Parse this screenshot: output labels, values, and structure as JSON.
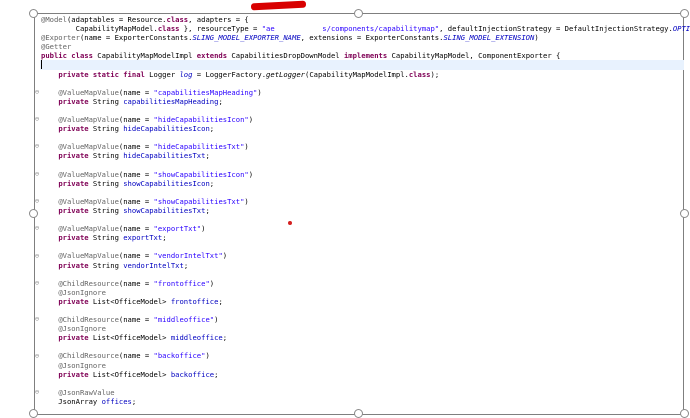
{
  "editor": {
    "lines": [
      [
        {
          "t": "@Model",
          "c": "a"
        },
        {
          "t": "(adaptables = Resource."
        },
        {
          "t": "class",
          "c": "k"
        },
        {
          "t": ", adapters = {"
        }
      ],
      [
        {
          "t": "        CapabilityMapModel."
        },
        {
          "t": "class",
          "c": "k"
        },
        {
          "t": " }, resourceType = "
        },
        {
          "t": "\"ae",
          "c": "s"
        },
        {
          "t": "           ",
          "c": "s"
        },
        {
          "t": "s/components/capabilitymap\"",
          "c": "s"
        },
        {
          "t": ", defaultInjectionStrategy = DefaultInjectionStrategy."
        },
        {
          "t": "OPTIONAL",
          "c": "fi"
        },
        {
          "t": ")"
        }
      ],
      [
        {
          "t": "@Exporter",
          "c": "a"
        },
        {
          "t": "(name = ExporterConstants."
        },
        {
          "t": "SLING_MODEL_EXPORTER_NAME",
          "c": "fi"
        },
        {
          "t": ", extensions = ExporterConstants."
        },
        {
          "t": "SLING_MODEL_EXTENSION",
          "c": "fi"
        },
        {
          "t": ")"
        }
      ],
      [
        {
          "t": "@Getter",
          "c": "a"
        }
      ],
      [
        {
          "t": "public class",
          "c": "k"
        },
        {
          "t": " CapabilityMapModelImpl "
        },
        {
          "t": "extends",
          "c": "k"
        },
        {
          "t": " CapabilitiesDropDownModel "
        },
        {
          "t": "implements",
          "c": "k"
        },
        {
          "t": " CapabilityMapModel, ComponentExporter {"
        }
      ],
      [],
      [
        {
          "t": "    "
        },
        {
          "t": "private static final",
          "c": "k"
        },
        {
          "t": " Logger "
        },
        {
          "t": "log",
          "c": "fi"
        },
        {
          "t": " = LoggerFactory."
        },
        {
          "t": "getLogger",
          "c": "it"
        },
        {
          "t": "(CapabilityMapModelImpl."
        },
        {
          "t": "class",
          "c": "k"
        },
        {
          "t": ");"
        }
      ],
      [],
      [
        {
          "t": "    "
        },
        {
          "t": "@ValueMapValue",
          "c": "a"
        },
        {
          "t": "(name = "
        },
        {
          "t": "\"capabilitiesMapHeading\"",
          "c": "s"
        },
        {
          "t": ")"
        }
      ],
      [
        {
          "t": "    "
        },
        {
          "t": "private",
          "c": "k"
        },
        {
          "t": " String "
        },
        {
          "t": "capabilitiesMapHeading",
          "c": "f"
        },
        {
          "t": ";"
        }
      ],
      [],
      [
        {
          "t": "    "
        },
        {
          "t": "@ValueMapValue",
          "c": "a"
        },
        {
          "t": "(name = "
        },
        {
          "t": "\"hideCapabilitiesIcon\"",
          "c": "s"
        },
        {
          "t": ")"
        }
      ],
      [
        {
          "t": "    "
        },
        {
          "t": "private",
          "c": "k"
        },
        {
          "t": " String "
        },
        {
          "t": "hideCapabilitiesIcon",
          "c": "f"
        },
        {
          "t": ";"
        }
      ],
      [],
      [
        {
          "t": "    "
        },
        {
          "t": "@ValueMapValue",
          "c": "a"
        },
        {
          "t": "(name = "
        },
        {
          "t": "\"hideCapabilitiesTxt\"",
          "c": "s"
        },
        {
          "t": ")"
        }
      ],
      [
        {
          "t": "    "
        },
        {
          "t": "private",
          "c": "k"
        },
        {
          "t": " String "
        },
        {
          "t": "hideCapabilitiesTxt",
          "c": "f"
        },
        {
          "t": ";"
        }
      ],
      [],
      [
        {
          "t": "    "
        },
        {
          "t": "@ValueMapValue",
          "c": "a"
        },
        {
          "t": "(name = "
        },
        {
          "t": "\"showCapabilitiesIcon\"",
          "c": "s"
        },
        {
          "t": ")"
        }
      ],
      [
        {
          "t": "    "
        },
        {
          "t": "private",
          "c": "k"
        },
        {
          "t": " String "
        },
        {
          "t": "showCapabilitiesIcon",
          "c": "f"
        },
        {
          "t": ";"
        }
      ],
      [],
      [
        {
          "t": "    "
        },
        {
          "t": "@ValueMapValue",
          "c": "a"
        },
        {
          "t": "(name = "
        },
        {
          "t": "\"showCapabilitiesTxt\"",
          "c": "s"
        },
        {
          "t": ")"
        }
      ],
      [
        {
          "t": "    "
        },
        {
          "t": "private",
          "c": "k"
        },
        {
          "t": " String "
        },
        {
          "t": "showCapabilitiesTxt",
          "c": "f"
        },
        {
          "t": ";"
        }
      ],
      [],
      [
        {
          "t": "    "
        },
        {
          "t": "@ValueMapValue",
          "c": "a"
        },
        {
          "t": "(name = "
        },
        {
          "t": "\"exportTxt\"",
          "c": "s"
        },
        {
          "t": ")"
        }
      ],
      [
        {
          "t": "    "
        },
        {
          "t": "private",
          "c": "k"
        },
        {
          "t": " String "
        },
        {
          "t": "exportTxt",
          "c": "f"
        },
        {
          "t": ";"
        }
      ],
      [],
      [
        {
          "t": "    "
        },
        {
          "t": "@ValueMapValue",
          "c": "a"
        },
        {
          "t": "(name = "
        },
        {
          "t": "\"vendorIntelTxt\"",
          "c": "s"
        },
        {
          "t": ")"
        }
      ],
      [
        {
          "t": "    "
        },
        {
          "t": "private",
          "c": "k"
        },
        {
          "t": " String "
        },
        {
          "t": "vendorIntelTxt",
          "c": "f"
        },
        {
          "t": ";"
        }
      ],
      [],
      [
        {
          "t": "    "
        },
        {
          "t": "@ChildResource",
          "c": "a"
        },
        {
          "t": "(name = "
        },
        {
          "t": "\"frontoffice\"",
          "c": "s"
        },
        {
          "t": ")"
        }
      ],
      [
        {
          "t": "    "
        },
        {
          "t": "@JsonIgnore",
          "c": "a"
        }
      ],
      [
        {
          "t": "    "
        },
        {
          "t": "private",
          "c": "k"
        },
        {
          "t": " List<OfficeModel> "
        },
        {
          "t": "frontoffice",
          "c": "f"
        },
        {
          "t": ";"
        }
      ],
      [],
      [
        {
          "t": "    "
        },
        {
          "t": "@ChildResource",
          "c": "a"
        },
        {
          "t": "(name = "
        },
        {
          "t": "\"middleoffice\"",
          "c": "s"
        },
        {
          "t": ")"
        }
      ],
      [
        {
          "t": "    "
        },
        {
          "t": "@JsonIgnore",
          "c": "a"
        }
      ],
      [
        {
          "t": "    "
        },
        {
          "t": "private",
          "c": "k"
        },
        {
          "t": " List<OfficeModel> "
        },
        {
          "t": "middleoffice",
          "c": "f"
        },
        {
          "t": ";"
        }
      ],
      [],
      [
        {
          "t": "    "
        },
        {
          "t": "@ChildResource",
          "c": "a"
        },
        {
          "t": "(name = "
        },
        {
          "t": "\"backoffice\"",
          "c": "s"
        },
        {
          "t": ")"
        }
      ],
      [
        {
          "t": "    "
        },
        {
          "t": "@JsonIgnore",
          "c": "a"
        }
      ],
      [
        {
          "t": "    "
        },
        {
          "t": "private",
          "c": "k"
        },
        {
          "t": " List<OfficeModel> "
        },
        {
          "t": "backoffice",
          "c": "f"
        },
        {
          "t": ";"
        }
      ],
      [],
      [
        {
          "t": "    "
        },
        {
          "t": "@JsonRawValue",
          "c": "a"
        }
      ],
      [
        {
          "t": "    JsonArray "
        },
        {
          "t": "offices",
          "c": "f"
        },
        {
          "t": ";"
        }
      ]
    ],
    "cursor_line_index": 5,
    "fold_marker_glyph": "⊖",
    "fold_line_indexes": [
      8,
      11,
      14,
      17,
      20,
      23,
      26,
      29,
      33,
      37,
      41
    ]
  }
}
